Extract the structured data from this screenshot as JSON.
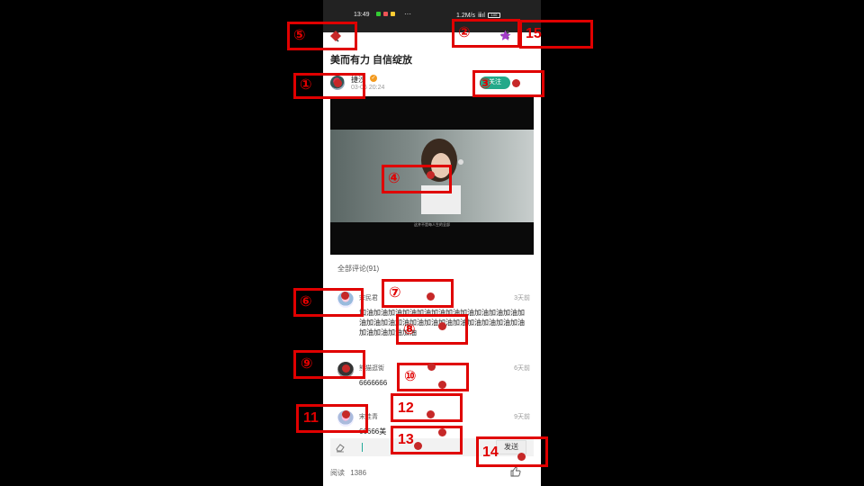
{
  "status_bar": {
    "time": "13:49",
    "ellipsis": "···",
    "net_speed": "1.2M/s",
    "signal": "ⅲıl",
    "battery": "100"
  },
  "article": {
    "title": "美而有力 自信绽放",
    "author": "捷沙",
    "post_time": "03-06 20:24",
    "follow_label": "关注",
    "video_caption": "这并不是每人生的全部"
  },
  "comments_header": "全部评论(91)",
  "comments": [
    {
      "name": "宋民君",
      "time": "3天前",
      "text": "加油加油加油加油加油加油加油加油加油加油加油加油加油加油加油加油加油加油加油加油加油加油加油加油加油加油加油"
    },
    {
      "name": "熊猫逛街",
      "time": "6天前",
      "text": "6666666"
    },
    {
      "name": "宋佳青",
      "time": "9天前",
      "text": "66666美"
    }
  ],
  "input": {
    "send_label": "发送"
  },
  "footer": {
    "read_label": "阅读",
    "read_count": "1386"
  },
  "annotations": [
    {
      "label": "①"
    },
    {
      "label": "②"
    },
    {
      "label": "③"
    },
    {
      "label": "④"
    },
    {
      "label": "⑤"
    },
    {
      "label": "⑥"
    },
    {
      "label": "⑦"
    },
    {
      "label": "⑧"
    },
    {
      "label": "⑨"
    },
    {
      "label": "⑩"
    },
    {
      "label": "11"
    },
    {
      "label": "12"
    },
    {
      "label": "13"
    },
    {
      "label": "14"
    },
    {
      "label": "15"
    }
  ],
  "colors": {
    "accent": "#24a98a",
    "annotation": "#e00000",
    "verified": "#f39a1e"
  }
}
